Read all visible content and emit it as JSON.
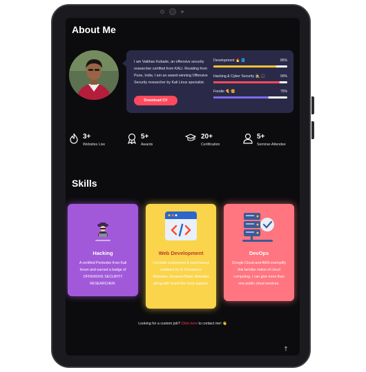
{
  "about": {
    "title": "About Me",
    "bio": "I am Vaibhav Kubade, an offensive security researcher certified from KALI. Residing from Pune, India. I am an award-winning Offensive Security researcher by Kali Linux specialist.",
    "cv_button": "Download CV",
    "skills": [
      {
        "label": "Development 🔥 📘",
        "percent_text": "85%",
        "value": 0.85,
        "color": "#ffc233"
      },
      {
        "label": "Hacking & Cyber Security 🕵️ 🎧",
        "percent_text": "90%",
        "value": 0.9,
        "color": "#ff4a5e"
      },
      {
        "label": "Foodie 🍕 🍔",
        "percent_text": "75%",
        "value": 0.75,
        "color": "#7e6cf0"
      }
    ]
  },
  "stats": [
    {
      "number": "3+",
      "caption": "Websites Live",
      "icon": "fire-icon"
    },
    {
      "number": "5+",
      "caption": "Awards",
      "icon": "award-icon"
    },
    {
      "number": "20+",
      "caption": "Certification",
      "icon": "graduation-cap-icon"
    },
    {
      "number": "5+",
      "caption": "Seminar-Attendee",
      "icon": "user-icon"
    }
  ],
  "skills_section": {
    "title": "Skills",
    "cards": [
      {
        "title": "Hacking",
        "description": "A certified Pentester from Kali forum and earned a badge of OFFENSIVE SECURITY RESEARCHER.",
        "bg": "#a259d9",
        "icon": "hacker-icon"
      },
      {
        "title": "Web Development",
        "description": "I provide customized & need-based solutions for E-Commerce Websites, Dynamic/Static Websites along with round the clock support.",
        "bg": "#fad44a",
        "icon": "code-window-icon"
      },
      {
        "title": "DevOps",
        "description": "Google Cloud and AWS exemplify this familiar notion of cloud computing. I can give more than one public cloud services.",
        "bg": "#ff7580",
        "icon": "server-check-icon"
      }
    ]
  },
  "footer": {
    "prefix": "Looking for a custom job? ",
    "link": "Click here",
    "suffix": " to contact me! 👋"
  },
  "to_top_icon": "arrow-up-icon"
}
